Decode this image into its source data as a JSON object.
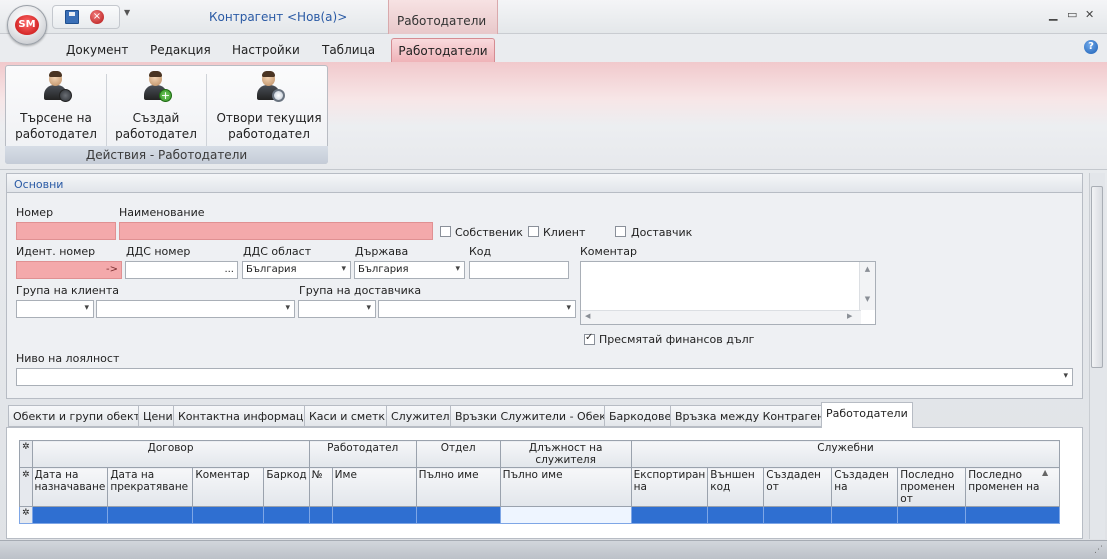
{
  "window": {
    "title": "Контрагент <Нов(а)>",
    "context_tab_group": "Работодатели",
    "logo_text": "SM"
  },
  "ribbon_tabs": [
    "Документ",
    "Редакция",
    "Настройки",
    "Таблица",
    "Работодатели"
  ],
  "ribbon": {
    "group_label": "Действия - Работодатели",
    "buttons": [
      {
        "line1": "Търсене на",
        "line2": "работодател",
        "icon": "search-employer-icon"
      },
      {
        "line1": "Създай",
        "line2": "работодател",
        "icon": "add-employer-icon"
      },
      {
        "line1": "Отвори текущия",
        "line2": "работодател",
        "icon": "open-employer-icon"
      }
    ]
  },
  "form": {
    "section_title": "Основни",
    "labels": {
      "number": "Номер",
      "name": "Наименование",
      "ident": "Идент. номер",
      "vat": "ДДС номер",
      "vat_region": "ДДС област",
      "country": "Държава",
      "code": "Код",
      "comment": "Коментар",
      "client_group": "Група на клиента",
      "supplier_group": "Група на доставчика",
      "loyalty": "Ниво на лоялност"
    },
    "checkboxes": {
      "own": "Собственик",
      "client": "Клиент",
      "supplier": "Доставчик",
      "calc_debt": "Пресмятай финансов дълг"
    },
    "values": {
      "ident_suffix": "->",
      "vat_suffix": "...",
      "vat_region": "България",
      "country": "България"
    }
  },
  "detail_tabs": [
    "Обекти и групи обекти",
    "Цени",
    "Контактна информация",
    "Каси и сметки",
    "Служители",
    "Връзки Служители - Обекти",
    "Баркодове",
    "Връзка между Контрагенти",
    "Работодатели"
  ],
  "grid": {
    "bands": [
      "Договор",
      "Работодател",
      "Отдел",
      "Длъжност на служителя",
      "Служебни"
    ],
    "columns": [
      {
        "l1": "Дата на",
        "l2": "назначаване"
      },
      {
        "l1": "Дата на",
        "l2": "прекратяване"
      },
      {
        "l1": "Коментар",
        "l2": ""
      },
      {
        "l1": "Баркод",
        "l2": ""
      },
      {
        "l1": "№",
        "l2": ""
      },
      {
        "l1": "Име",
        "l2": ""
      },
      {
        "l1": "Пълно име",
        "l2": ""
      },
      {
        "l1": "Пълно име",
        "l2": ""
      },
      {
        "l1": "Експортиран",
        "l2": "на"
      },
      {
        "l1": "Външен",
        "l2": "код"
      },
      {
        "l1": "Създаден",
        "l2": "от"
      },
      {
        "l1": "Създаден",
        "l2": "на"
      },
      {
        "l1": "Последно",
        "l2": "променен от"
      },
      {
        "l1": "Последно",
        "l2": "променен на"
      }
    ]
  },
  "colors": {
    "accent": "#2a5aa5",
    "required": "#f4a9ab",
    "selection": "#2f6fd1",
    "context_tab": "#efb3b8"
  }
}
